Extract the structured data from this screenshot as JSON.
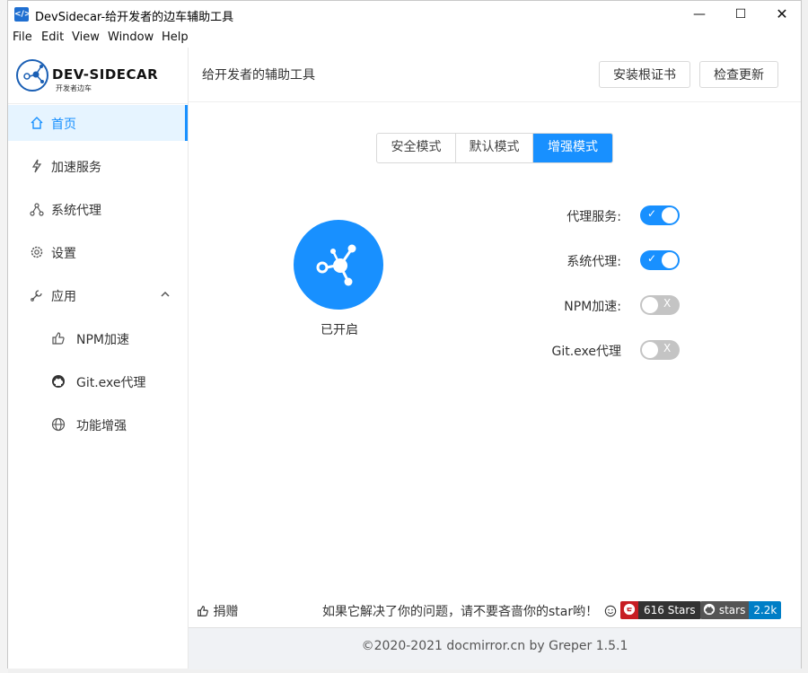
{
  "window": {
    "title": "DevSidecar-给开发者的边车辅助工具",
    "icon": "devsidecar-app-icon"
  },
  "menu": [
    "File",
    "Edit",
    "View",
    "Window",
    "Help"
  ],
  "logo": {
    "text": "DEV-SIDECAR",
    "sub": "开发者边车"
  },
  "sidebar": {
    "items": [
      {
        "label": "首页",
        "icon": "home-icon"
      },
      {
        "label": "加速服务",
        "icon": "lightning-icon"
      },
      {
        "label": "系统代理",
        "icon": "network-icon"
      },
      {
        "label": "设置",
        "icon": "gear-icon"
      },
      {
        "label": "应用",
        "icon": "tool-icon"
      }
    ],
    "sub_items": [
      {
        "label": "NPM加速",
        "icon": "like-icon"
      },
      {
        "label": "Git.exe代理",
        "icon": "github-icon"
      },
      {
        "label": "功能增强",
        "icon": "globe-icon"
      }
    ]
  },
  "header": {
    "title": "给开发者的辅助工具",
    "install_cert": "安装根证书",
    "check_update": "检查更新"
  },
  "modes": [
    "安全模式",
    "默认模式",
    "增强模式"
  ],
  "power": {
    "status": "已开启"
  },
  "switches": [
    {
      "label": "代理服务:",
      "on": true
    },
    {
      "label": "系统代理:",
      "on": true
    },
    {
      "label": "NPM加速:",
      "on": false
    },
    {
      "label": "Git.exe代理",
      "on": false
    }
  ],
  "switch_text": {
    "on": "✓",
    "off": "X"
  },
  "bottom": {
    "donate": "捐赠",
    "promo": "如果它解决了你的问题，请不要吝啬你的star哟！",
    "badge1_count": "616 Stars",
    "badge2_label": "stars",
    "badge2_count": "2.2k"
  },
  "footer": "©2020-2021 docmirror.cn by Greper 1.5.1",
  "colors": {
    "accent": "#1890ff",
    "gitee_red": "#c71d23",
    "badge_dark": "#555555",
    "badge_blue": "#007ec6"
  }
}
